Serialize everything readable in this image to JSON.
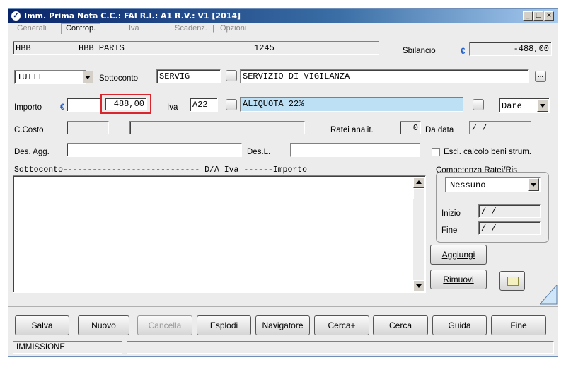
{
  "window": {
    "title": "Imm. Prima Nota C.C.: FAI  R.I.: A1  R.V.: V1  [2014]",
    "controls": [
      "_",
      "□",
      "×"
    ]
  },
  "tabs": [
    "Generali",
    "Controp.",
    "Iva",
    "Scadenz.",
    "Opzioni"
  ],
  "active_tab": "Controp.",
  "header": {
    "code": "HBB",
    "name": "HBB PARIS",
    "number": "1245",
    "sbilancio_label": "Sbilancio",
    "currency": "€",
    "sbilancio_value": "-488,00"
  },
  "row1": {
    "filter_value": "TUTTI",
    "sottoconto_label": "Sottoconto",
    "sottoconto_code": "SERVIG",
    "ellipsis": "...",
    "sottoconto_desc": "SERVIZIO DI VIGILANZA"
  },
  "row2": {
    "importo_label": "Importo",
    "currency": "€",
    "importo_value": "488,00",
    "iva_label": "Iva",
    "iva_code": "A22",
    "iva_desc": "ALIQUOTA 22%",
    "dare_avere": "Dare"
  },
  "row3": {
    "ccosto_label": "C.Costo",
    "ratei_label": "Ratei analit.",
    "ratei_value": "0",
    "dadata_label": "Da data",
    "dadata_value": " /  /"
  },
  "row4": {
    "desagg_label": "Des. Agg.",
    "desl_label": "Des.L.",
    "escl_label": "Escl. calcolo beni strum."
  },
  "list": {
    "header": "Sottoconto---------------------------- D/A  Iva  ------Importo"
  },
  "competenza": {
    "label": "Competenza Ratei/Ris",
    "value": "Nessuno",
    "inizio_label": "Inizio",
    "inizio_value": " /  /",
    "fine_label": "Fine",
    "fine_value": " /  /"
  },
  "side_buttons": {
    "aggiungi": "Aggiungi",
    "rimuovi": "Rimuovi"
  },
  "bottom_buttons": {
    "salva": "Salva",
    "nuovo": "Nuovo",
    "cancella": "Cancella",
    "esplodi": "Esplodi",
    "navigatore": "Navigatore",
    "cercaplus": "Cerca+",
    "cerca": "Cerca",
    "guida": "Guida",
    "fine": "Fine"
  },
  "status": {
    "mode": "IMMISSIONE"
  },
  "colors": {
    "highlight_border": "#d9262c",
    "iva_desc_bg": "#bde0f5",
    "tab_active_accent": "#f0a020"
  }
}
